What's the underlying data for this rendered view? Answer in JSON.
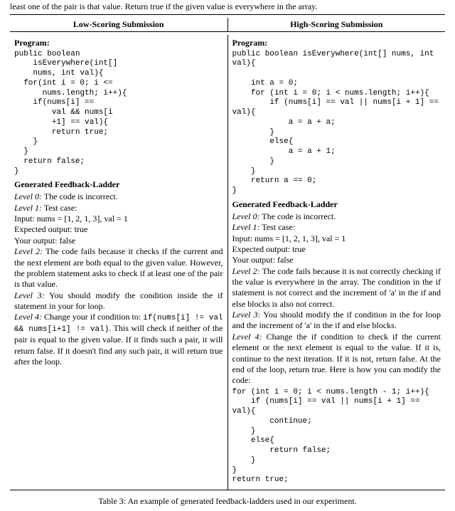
{
  "caption_top": "least one of the pair is that value. Return true if the given value is everywhere in the array.",
  "header": {
    "left": "Low-Scoring Submission",
    "right": "High-Scoring Submission"
  },
  "labels": {
    "program": "Program:",
    "feedback": "Generated Feedback-Ladder"
  },
  "left": {
    "code": "public boolean\n    isEverywhere(int[]\n    nums, int val){\n  for(int i = 0; i <=\n      nums.length; i++){\n    if(nums[i] ==\n        val && nums[i\n        +1] == val){\n        return true;\n    }\n  }\n  return false;\n}",
    "lvl0_label": "Level 0:",
    "lvl0_text": "The code is incorrect.",
    "lvl1_label": "Level 1:",
    "lvl1_text": "Test case:",
    "input_line": "Input: nums = [1, 2, 1, 3], val = 1",
    "expected_line": "Expected output: true",
    "your_line": "Your output: false",
    "lvl2_label": "Level 2:",
    "lvl2_text": "The code fails because it checks if the current and the next element are both equal to the given value. However, the problem statement asks to check if at least one of the pair is that value.",
    "lvl3_label": "Level 3:",
    "lvl3_text": "You should modify the condition inside the if statement in your for loop.",
    "lvl4_label": "Level 4:",
    "lvl4_pre": "Change your if condition to: ",
    "lvl4_code": "if(nums[i] != val && nums[i+1] != val)",
    "lvl4_post": ". This will check if neither of the pair is equal to the given value. If it finds such a pair, it will return false. If it doesn't find any such pair, it will return true after the loop."
  },
  "right": {
    "code": "public boolean isEverywhere(int[] nums, int val){\n\n    int a = 0;\n    for (int i = 0; i < nums.length; i++){\n        if (nums[i] == val || nums[i + 1] == val){\n            a = a + a;\n        }\n        else{\n            a = a + 1;\n        }\n    }\n    return a == 0;\n}",
    "lvl0_label": "Level 0:",
    "lvl0_text": "The code is incorrect.",
    "lvl1_label": "Level 1:",
    "lvl1_text": "Test case:",
    "input_line": "Input: nums = [1, 2, 1, 3], val = 1",
    "expected_line": "Expected output: true",
    "your_line": "Your output: false",
    "lvl2_label": "Level 2:",
    "lvl2_text": "The code fails because it is not correctly checking if the value is everywhere in the array. The condition in the if statement is not correct and the increment of 'a' in the if and else blocks is also not correct.",
    "lvl3_label": "Level 3:",
    "lvl3_text": "You should modify the if condition in the for loop and the increment of 'a' in the if and else blocks.",
    "lvl4_label": "Level 4:",
    "lvl4_text": "Change the if condition to check if the current element or the next element is equal to the value. If it is, continue to the next iteration. If it is not, return false. At the end of the loop, return true. Here is how you can modify the code:",
    "code2": "for (int i = 0; i < nums.length - 1; i++){\n    if (nums[i] == val || nums[i + 1] == val){\n        continue;\n    }\n    else{\n        return false;\n    }\n}\nreturn true;"
  },
  "table_caption": "Table 3: An example of generated feedback-ladders used in our experiment."
}
